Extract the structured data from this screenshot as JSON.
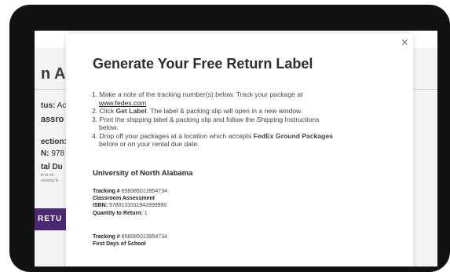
{
  "background": {
    "title_fragment": "n Al",
    "rows": [
      {
        "label": "tus:",
        "value": " Ac"
      },
      {
        "label": "assro",
        "value": ""
      },
      {
        "label": "ection:",
        "value": ""
      },
      {
        "label": "N:",
        "value": " 978"
      },
      {
        "label": "tal Du",
        "value": ""
      }
    ],
    "tiny_lines": [
      "le to ret",
      "cessing fe"
    ],
    "button_label": "RETU"
  },
  "modal": {
    "title": "Generate Your Free Return Label",
    "close_icon": "×",
    "steps": {
      "s1_text": "1. Make a note of the tracking number(s) below. Track your package at",
      "s1_link": "www.fedex.com",
      "s2_pre": "2. Click ",
      "s2_bold": "Get Label",
      "s2_post": ". The label & packing slip will open in a new window.",
      "s3_line1": "3. Print the shipping label & packing slip and follow the Shipping Instructions",
      "s3_line2": "below.",
      "s4_pre": "4. Drop off your packages at a location which accepts ",
      "s4_bold": "FedEx Ground Packages",
      "s4_line2": "before or on your rental due date."
    },
    "university": "University of North Alabama",
    "items": [
      {
        "tracking_label": "Tracking #",
        "tracking": " 656085013954734",
        "title": "Classroom Assessment",
        "isbn_label": "ISBN:",
        "isbn": " 9780133311942899990",
        "qty_label": "Quantity to Return:",
        "qty": " 1"
      },
      {
        "tracking_label": "Tracking #",
        "tracking": " 656085013954734",
        "title": "First Days of School"
      }
    ]
  }
}
